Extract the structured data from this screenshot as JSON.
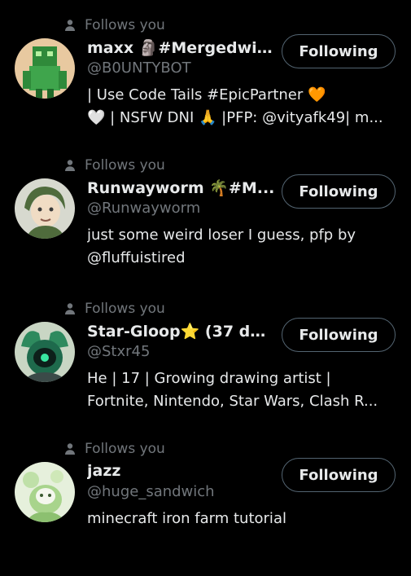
{
  "follows_label": "Follows you",
  "button_label": "Following",
  "users": [
    {
      "name": "maxx 🗿#Mergedwit...",
      "handle": "@B0UNTYBOT",
      "bio": [
        "| Use Code Tails #EpicPartner 🧡",
        "🤍 | NSFW DNI 🙏 |PFP: @vityafk49| m..."
      ],
      "avatar_color": "#2f8a3a"
    },
    {
      "name": "Runwayworm 🌴#M...",
      "handle": "@Runwayworm",
      "bio": [
        "just some weird loser I guess, pfp by",
        "@fluffuistired"
      ],
      "avatar_color": "#7a8f72"
    },
    {
      "name": "Star-Gloop⭐ (37 da...",
      "handle": "@Stxr45",
      "bio": [
        "He | 17 | Growing drawing artist |",
        "Fortnite, Nintendo, Star Wars, Clash R..."
      ],
      "avatar_color": "#1e6a4c"
    },
    {
      "name": "jazz",
      "handle": "@huge_sandwich",
      "bio": [
        "minecraft iron farm tutorial"
      ],
      "avatar_color": "#bfe0a8"
    }
  ]
}
